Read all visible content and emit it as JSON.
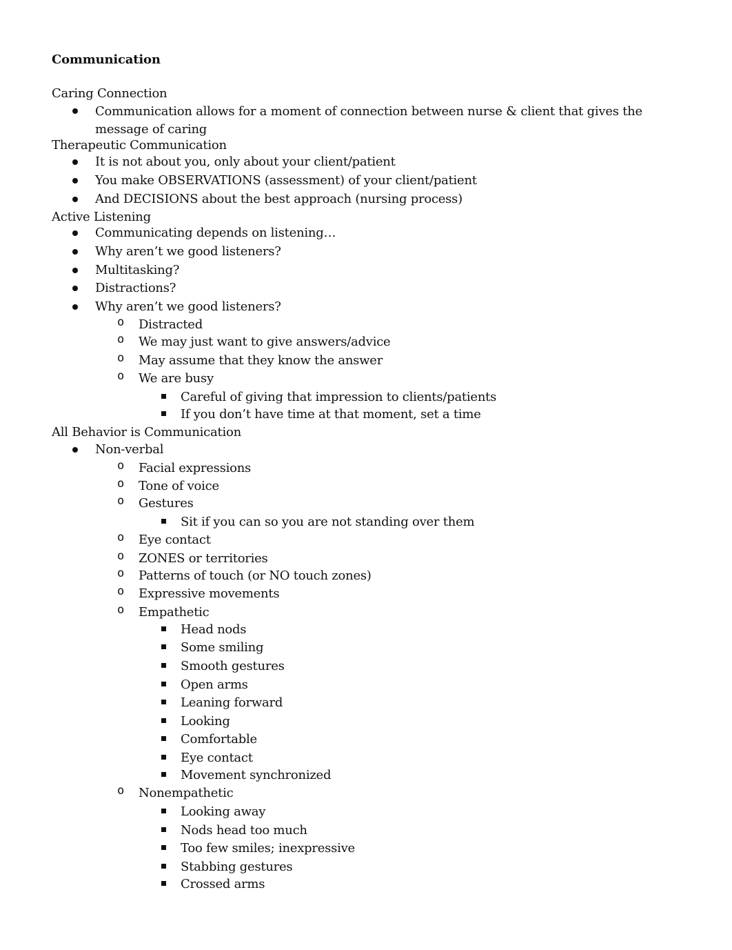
{
  "document": {
    "title": "Communication",
    "items": [
      {
        "level": 0,
        "text": "Caring Connection"
      },
      {
        "level": 1,
        "text": "Communication allows for a moment of connection between nurse & client that gives the message of caring",
        "wrap": true
      },
      {
        "level": 0,
        "text": "Therapeutic Communication"
      },
      {
        "level": 1,
        "text": "It is not about you, only about your client/patient"
      },
      {
        "level": 1,
        "text": "You make OBSERVATIONS (assessment) of your client/patient"
      },
      {
        "level": 1,
        "text": "And DECISIONS about the best approach (nursing process)"
      },
      {
        "level": 0,
        "text": "Active Listening"
      },
      {
        "level": 1,
        "text": "Communicating depends on listening…"
      },
      {
        "level": 1,
        "text": "Why aren’t we good listeners?"
      },
      {
        "level": 1,
        "text": "Multitasking?"
      },
      {
        "level": 1,
        "text": "Distractions?"
      },
      {
        "level": 1,
        "text": "Why aren’t we good listeners?"
      },
      {
        "level": 2,
        "text": "Distracted"
      },
      {
        "level": 2,
        "text": "We may just want to give answers/advice"
      },
      {
        "level": 2,
        "text": "May assume that they know the answer"
      },
      {
        "level": 2,
        "text": "We are busy"
      },
      {
        "level": 3,
        "text": "Careful of giving that impression to clients/patients"
      },
      {
        "level": 3,
        "text": "If you don’t have time at that moment, set a time"
      },
      {
        "level": 0,
        "text": "All Behavior is Communication"
      },
      {
        "level": 1,
        "text": "Non-verbal"
      },
      {
        "level": 2,
        "text": "Facial expressions"
      },
      {
        "level": 2,
        "text": "Tone of voice"
      },
      {
        "level": 2,
        "text": "Gestures"
      },
      {
        "level": 3,
        "text": "Sit if you can so you are not standing over them"
      },
      {
        "level": 2,
        "text": "Eye contact"
      },
      {
        "level": 2,
        "text": "ZONES or territories"
      },
      {
        "level": 2,
        "text": "Patterns of touch (or NO touch zones)"
      },
      {
        "level": 2,
        "text": "Expressive movements"
      },
      {
        "level": 2,
        "text": "Empathetic"
      },
      {
        "level": 3,
        "text": "Head nods"
      },
      {
        "level": 3,
        "text": "Some smiling"
      },
      {
        "level": 3,
        "text": "Smooth gestures"
      },
      {
        "level": 3,
        "text": "Open arms"
      },
      {
        "level": 3,
        "text": "Leaning forward"
      },
      {
        "level": 3,
        "text": "Looking"
      },
      {
        "level": 3,
        "text": "Comfortable"
      },
      {
        "level": 3,
        "text": "Eye contact"
      },
      {
        "level": 3,
        "text": "Movement synchronized"
      },
      {
        "level": 2,
        "text": "Nonempathetic"
      },
      {
        "level": 3,
        "text": "Looking away"
      },
      {
        "level": 3,
        "text": "Nods head too much"
      },
      {
        "level": 3,
        "text": "Too few smiles; inexpressive"
      },
      {
        "level": 3,
        "text": "Stabbing gestures"
      },
      {
        "level": 3,
        "text": "Crossed arms"
      }
    ],
    "markers": {
      "level1": "•",
      "level2": "o",
      "level3": "▪"
    }
  }
}
